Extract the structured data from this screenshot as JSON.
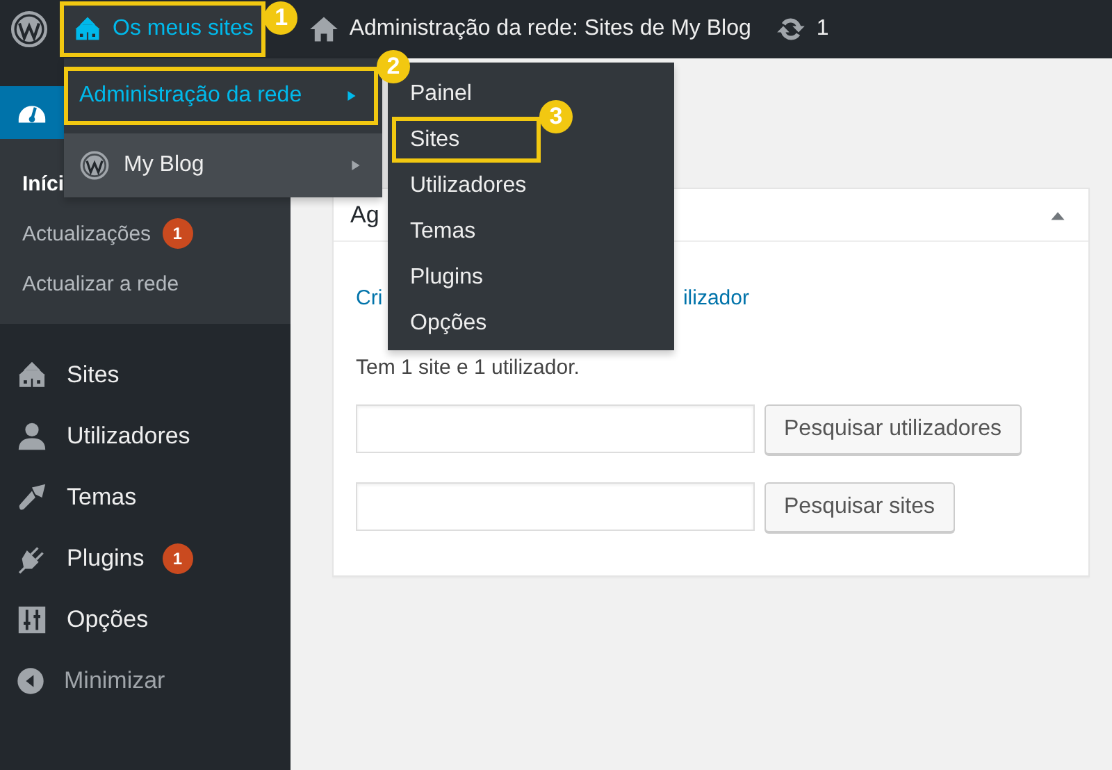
{
  "admin_bar": {
    "items": [
      {
        "kind": "logo",
        "selected": false
      },
      {
        "kind": "sites",
        "label": "Os meus sites",
        "selected": true,
        "callout": "1"
      },
      {
        "kind": "home",
        "label": "Administração da rede: Sites de My Blog",
        "selected": false
      },
      {
        "kind": "updates",
        "label": "1",
        "selected": false
      }
    ]
  },
  "sidebar": {
    "dashboard": {
      "selected": true
    },
    "submenu": [
      {
        "label": "Iníci",
        "selected": true
      },
      {
        "label": "Actualizações",
        "badge": "1",
        "selected": false
      },
      {
        "label": "Actualizar a rede",
        "selected": false
      }
    ],
    "items": [
      {
        "kind": "sites",
        "label": "Sites"
      },
      {
        "kind": "users",
        "label": "Utilizadores"
      },
      {
        "kind": "themes",
        "label": "Temas"
      },
      {
        "kind": "plugins",
        "label": "Plugins",
        "badge": "1"
      },
      {
        "kind": "settings",
        "label": "Opções"
      },
      {
        "kind": "collapse",
        "label": "Minimizar"
      }
    ]
  },
  "widget": {
    "title": "Ag",
    "expanded": true,
    "links": [
      "Cri",
      "ilizador"
    ],
    "summary": "Tem 1 site e 1 utilizador.",
    "searches": [
      {
        "button": "Pesquisar utilizadores"
      },
      {
        "button": "Pesquisar sites"
      }
    ]
  },
  "menu": {
    "items": [
      {
        "kind": "plain",
        "label": "Administração da rede",
        "selected": true,
        "callout": "2"
      },
      {
        "kind": "blog",
        "label": "My Blog",
        "selected": false
      }
    ]
  },
  "submenu": {
    "items": [
      {
        "label": "Painel"
      },
      {
        "label": "Sites",
        "callout": "3"
      },
      {
        "label": "Utilizadores"
      },
      {
        "label": "Temas"
      },
      {
        "label": "Plugins"
      },
      {
        "label": "Opções"
      }
    ]
  }
}
